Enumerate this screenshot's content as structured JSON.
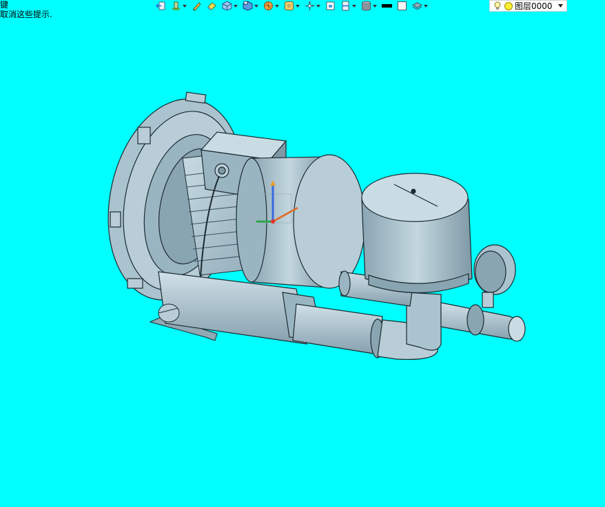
{
  "hints": {
    "line1": "键",
    "line2": "取消这些提示."
  },
  "toolbar": {
    "buttons": [
      {
        "icon": "exit-icon",
        "dropdown": false
      },
      {
        "icon": "sketch-tools-icon",
        "dropdown": true
      },
      {
        "icon": "pencil-icon",
        "dropdown": false
      },
      {
        "icon": "eraser-icon",
        "dropdown": false
      },
      {
        "icon": "cube-icon",
        "dropdown": true
      },
      {
        "icon": "view-cube-icon",
        "dropdown": true
      },
      {
        "icon": "render-ball-icon",
        "dropdown": true
      },
      {
        "icon": "filter-icon",
        "dropdown": true
      },
      {
        "icon": "orient-axes-icon",
        "dropdown": true
      },
      {
        "icon": "fit-view-icon",
        "dropdown": false
      },
      {
        "icon": "section-view-icon",
        "dropdown": true
      },
      {
        "icon": "material-cylinder-icon",
        "dropdown": true
      },
      {
        "icon": "line-color-icon",
        "dropdown": false
      },
      {
        "icon": "fill-color-icon",
        "dropdown": false
      },
      {
        "icon": "layer-stack-icon",
        "dropdown": true
      }
    ],
    "layer_selector": {
      "label": "图层0000"
    }
  },
  "colors": {
    "background": "#00ffff",
    "model_fill": "#a9c3cf",
    "model_dark": "#7f99a6",
    "model_light": "#c9dce4",
    "edge": "#1b2a30"
  }
}
